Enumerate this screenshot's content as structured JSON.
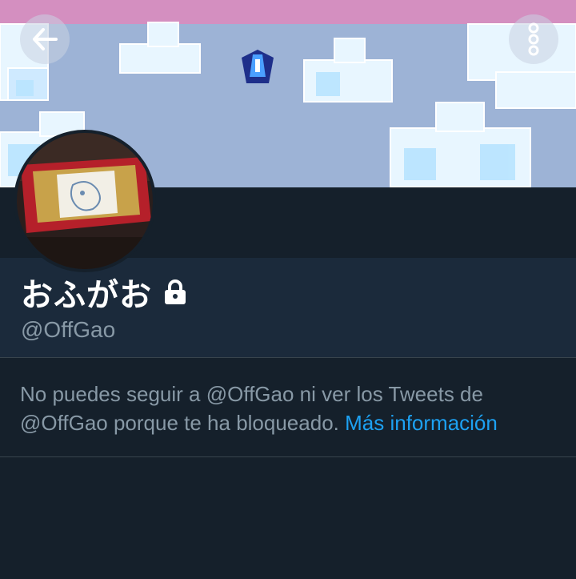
{
  "profile": {
    "display_name": "おふがお",
    "handle": "@OffGao",
    "locked": true
  },
  "blocked_notice": {
    "text": "No puedes seguir a @OffGao ni ver los Tweets de @OffGao porque te ha bloqueado.",
    "link_label": "Más información"
  },
  "icons": {
    "back": "arrow-left-icon",
    "more": "vertical-dots-icon",
    "lock": "lock-icon"
  },
  "colors": {
    "background": "#15202b",
    "info_panel": "#1b2a3b",
    "link": "#1da1f2",
    "muted_text": "#8899a6",
    "banner_sky": "#9db3d6",
    "banner_top": "#d48fc0"
  }
}
